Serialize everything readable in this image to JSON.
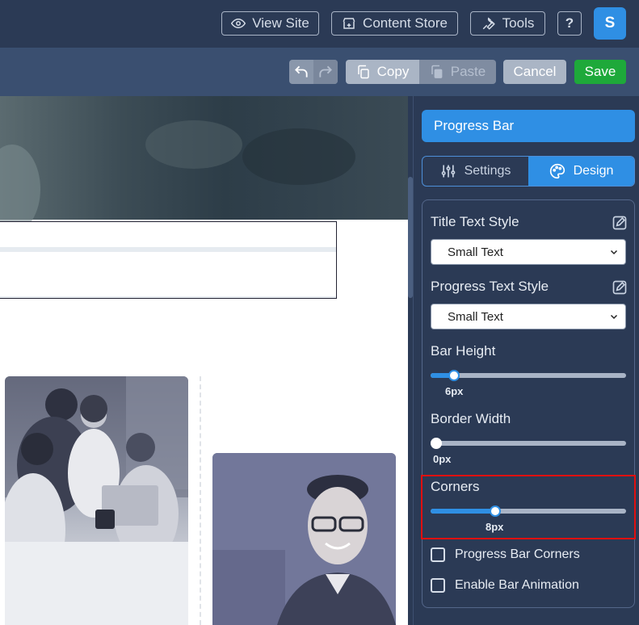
{
  "topbar": {
    "view_site": "View Site",
    "content_store": "Content Store",
    "tools": "Tools",
    "help": "?",
    "avatar": "S"
  },
  "toolbar": {
    "copy": "Copy",
    "paste": "Paste",
    "cancel": "Cancel",
    "save": "Save"
  },
  "panel": {
    "title": "Progress Bar",
    "tabs": [
      {
        "label": "Settings",
        "icon": "sliders-icon",
        "active": false
      },
      {
        "label": "Design",
        "icon": "palette-icon",
        "active": true
      }
    ],
    "title_text_style": {
      "label": "Title Text Style",
      "value": "Small Text"
    },
    "progress_text_style": {
      "label": "Progress Text Style",
      "value": "Small Text"
    },
    "bar_height": {
      "label": "Bar Height",
      "value_text": "6px",
      "fraction": 0.12
    },
    "border_width": {
      "label": "Border Width",
      "value_text": "0px",
      "fraction": 0.0
    },
    "corners": {
      "label": "Corners",
      "value_text": "8px",
      "fraction": 0.33
    },
    "checkboxes": [
      {
        "label": "Progress Bar Corners",
        "checked": false
      },
      {
        "label": "Enable Bar Animation",
        "checked": false
      }
    ]
  },
  "colors": {
    "accent": "#2f8fe4",
    "save": "#1ea93a",
    "highlight": "#e01010"
  }
}
